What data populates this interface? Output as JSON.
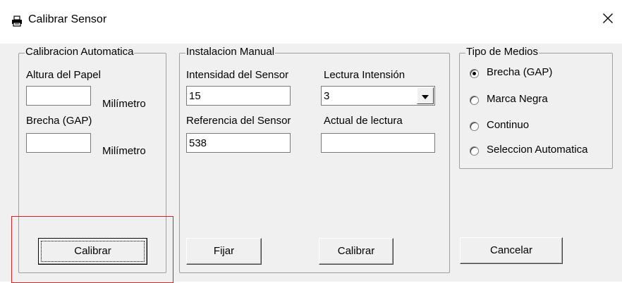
{
  "window": {
    "title": "Calibrar Sensor",
    "close_symbol": "✕"
  },
  "auto": {
    "group_title": "Calibracion Automatica",
    "paper_height_label": "Altura del Papel",
    "paper_height_value": "",
    "unit_1": "Milímetro",
    "gap_label": "Brecha (GAP)",
    "gap_value": "",
    "unit_2": "Milímetro",
    "calibrate_button": "Calibrar"
  },
  "manual": {
    "group_title": "Instalacion Manual",
    "intensity_label": "Intensidad del Sensor",
    "intensity_value": "15",
    "reading_intensity_label": "Lectura Intensión",
    "reading_intensity_value": "3",
    "reference_label": "Referencia del Sensor",
    "reference_value": "538",
    "current_reading_label": "Actual de lectura",
    "current_reading_value": "",
    "set_button": "Fijar",
    "calibrate_button": "Calibrar"
  },
  "media": {
    "group_title": "Tipo de Medios",
    "options": [
      {
        "label": "Brecha (GAP)",
        "selected": true
      },
      {
        "label": "Marca Negra",
        "selected": false
      },
      {
        "label": "Continuo",
        "selected": false
      },
      {
        "label": "Seleccion Automatica",
        "selected": false
      }
    ],
    "cancel_button": "Cancelar"
  },
  "colors": {
    "highlight": "#e02020",
    "dialog_bg": "#f0f0f0"
  }
}
